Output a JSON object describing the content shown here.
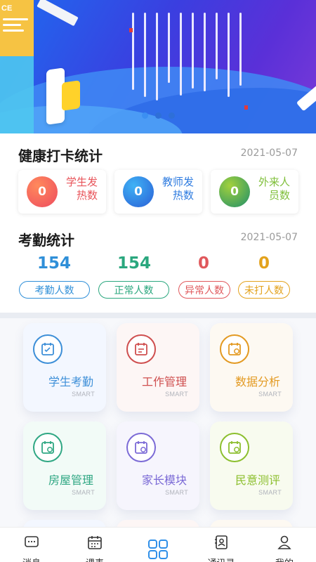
{
  "banner": {
    "card_text": "CE"
  },
  "health": {
    "title": "健康打卡统计",
    "date": "2021-05-07",
    "cards": [
      {
        "value": "0",
        "label": "学生发热数",
        "color": "#e8545a"
      },
      {
        "value": "0",
        "label": "教师发热数",
        "color": "#2f7ce0"
      },
      {
        "value": "0",
        "label": "外来人员数",
        "color": "#7fbf3a"
      }
    ]
  },
  "attendance": {
    "title": "考勤统计",
    "date": "2021-05-07",
    "stats": [
      {
        "value": "154",
        "label": "考勤人数",
        "color": "#2f8fd8"
      },
      {
        "value": "154",
        "label": "正常人数",
        "color": "#2aa77e"
      },
      {
        "value": "0",
        "label": "异常人数",
        "color": "#e0585c"
      },
      {
        "value": "0",
        "label": "未打人数",
        "color": "#e3a21c"
      }
    ]
  },
  "modules": [
    {
      "label": "学生考勤",
      "sub": "SMART",
      "color": "#3d8fd8"
    },
    {
      "label": "工作管理",
      "sub": "SMART",
      "color": "#cf4f4f"
    },
    {
      "label": "数据分析",
      "sub": "SMART",
      "color": "#e39a22"
    },
    {
      "label": "房屋管理",
      "sub": "SMART",
      "color": "#2fa783"
    },
    {
      "label": "家长模块",
      "sub": "SMART",
      "color": "#7b6ad6"
    },
    {
      "label": "民意测评",
      "sub": "SMART",
      "color": "#8cbf2e"
    }
  ],
  "nav": [
    {
      "label": "消息",
      "icon": "message-icon"
    },
    {
      "label": "课表",
      "icon": "calendar-icon"
    },
    {
      "label": "",
      "icon": "apps-grid-icon",
      "accent": "#2f8fe8"
    },
    {
      "label": "通讯录",
      "icon": "contacts-icon"
    },
    {
      "label": "我的",
      "icon": "user-icon"
    }
  ]
}
